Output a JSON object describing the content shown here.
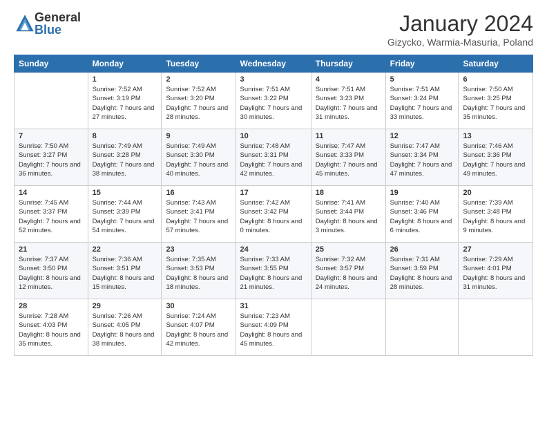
{
  "logo": {
    "general": "General",
    "blue": "Blue"
  },
  "header": {
    "title": "January 2024",
    "location": "Gizycko, Warmia-Masuria, Poland"
  },
  "weekdays": [
    "Sunday",
    "Monday",
    "Tuesday",
    "Wednesday",
    "Thursday",
    "Friday",
    "Saturday"
  ],
  "weeks": [
    [
      {
        "day": "",
        "sunrise": "",
        "sunset": "",
        "daylight": ""
      },
      {
        "day": "1",
        "sunrise": "Sunrise: 7:52 AM",
        "sunset": "Sunset: 3:19 PM",
        "daylight": "Daylight: 7 hours and 27 minutes."
      },
      {
        "day": "2",
        "sunrise": "Sunrise: 7:52 AM",
        "sunset": "Sunset: 3:20 PM",
        "daylight": "Daylight: 7 hours and 28 minutes."
      },
      {
        "day": "3",
        "sunrise": "Sunrise: 7:51 AM",
        "sunset": "Sunset: 3:22 PM",
        "daylight": "Daylight: 7 hours and 30 minutes."
      },
      {
        "day": "4",
        "sunrise": "Sunrise: 7:51 AM",
        "sunset": "Sunset: 3:23 PM",
        "daylight": "Daylight: 7 hours and 31 minutes."
      },
      {
        "day": "5",
        "sunrise": "Sunrise: 7:51 AM",
        "sunset": "Sunset: 3:24 PM",
        "daylight": "Daylight: 7 hours and 33 minutes."
      },
      {
        "day": "6",
        "sunrise": "Sunrise: 7:50 AM",
        "sunset": "Sunset: 3:25 PM",
        "daylight": "Daylight: 7 hours and 35 minutes."
      }
    ],
    [
      {
        "day": "7",
        "sunrise": "Sunrise: 7:50 AM",
        "sunset": "Sunset: 3:27 PM",
        "daylight": "Daylight: 7 hours and 36 minutes."
      },
      {
        "day": "8",
        "sunrise": "Sunrise: 7:49 AM",
        "sunset": "Sunset: 3:28 PM",
        "daylight": "Daylight: 7 hours and 38 minutes."
      },
      {
        "day": "9",
        "sunrise": "Sunrise: 7:49 AM",
        "sunset": "Sunset: 3:30 PM",
        "daylight": "Daylight: 7 hours and 40 minutes."
      },
      {
        "day": "10",
        "sunrise": "Sunrise: 7:48 AM",
        "sunset": "Sunset: 3:31 PM",
        "daylight": "Daylight: 7 hours and 42 minutes."
      },
      {
        "day": "11",
        "sunrise": "Sunrise: 7:47 AM",
        "sunset": "Sunset: 3:33 PM",
        "daylight": "Daylight: 7 hours and 45 minutes."
      },
      {
        "day": "12",
        "sunrise": "Sunrise: 7:47 AM",
        "sunset": "Sunset: 3:34 PM",
        "daylight": "Daylight: 7 hours and 47 minutes."
      },
      {
        "day": "13",
        "sunrise": "Sunrise: 7:46 AM",
        "sunset": "Sunset: 3:36 PM",
        "daylight": "Daylight: 7 hours and 49 minutes."
      }
    ],
    [
      {
        "day": "14",
        "sunrise": "Sunrise: 7:45 AM",
        "sunset": "Sunset: 3:37 PM",
        "daylight": "Daylight: 7 hours and 52 minutes."
      },
      {
        "day": "15",
        "sunrise": "Sunrise: 7:44 AM",
        "sunset": "Sunset: 3:39 PM",
        "daylight": "Daylight: 7 hours and 54 minutes."
      },
      {
        "day": "16",
        "sunrise": "Sunrise: 7:43 AM",
        "sunset": "Sunset: 3:41 PM",
        "daylight": "Daylight: 7 hours and 57 minutes."
      },
      {
        "day": "17",
        "sunrise": "Sunrise: 7:42 AM",
        "sunset": "Sunset: 3:42 PM",
        "daylight": "Daylight: 8 hours and 0 minutes."
      },
      {
        "day": "18",
        "sunrise": "Sunrise: 7:41 AM",
        "sunset": "Sunset: 3:44 PM",
        "daylight": "Daylight: 8 hours and 3 minutes."
      },
      {
        "day": "19",
        "sunrise": "Sunrise: 7:40 AM",
        "sunset": "Sunset: 3:46 PM",
        "daylight": "Daylight: 8 hours and 6 minutes."
      },
      {
        "day": "20",
        "sunrise": "Sunrise: 7:39 AM",
        "sunset": "Sunset: 3:48 PM",
        "daylight": "Daylight: 8 hours and 9 minutes."
      }
    ],
    [
      {
        "day": "21",
        "sunrise": "Sunrise: 7:37 AM",
        "sunset": "Sunset: 3:50 PM",
        "daylight": "Daylight: 8 hours and 12 minutes."
      },
      {
        "day": "22",
        "sunrise": "Sunrise: 7:36 AM",
        "sunset": "Sunset: 3:51 PM",
        "daylight": "Daylight: 8 hours and 15 minutes."
      },
      {
        "day": "23",
        "sunrise": "Sunrise: 7:35 AM",
        "sunset": "Sunset: 3:53 PM",
        "daylight": "Daylight: 8 hours and 18 minutes."
      },
      {
        "day": "24",
        "sunrise": "Sunrise: 7:33 AM",
        "sunset": "Sunset: 3:55 PM",
        "daylight": "Daylight: 8 hours and 21 minutes."
      },
      {
        "day": "25",
        "sunrise": "Sunrise: 7:32 AM",
        "sunset": "Sunset: 3:57 PM",
        "daylight": "Daylight: 8 hours and 24 minutes."
      },
      {
        "day": "26",
        "sunrise": "Sunrise: 7:31 AM",
        "sunset": "Sunset: 3:59 PM",
        "daylight": "Daylight: 8 hours and 28 minutes."
      },
      {
        "day": "27",
        "sunrise": "Sunrise: 7:29 AM",
        "sunset": "Sunset: 4:01 PM",
        "daylight": "Daylight: 8 hours and 31 minutes."
      }
    ],
    [
      {
        "day": "28",
        "sunrise": "Sunrise: 7:28 AM",
        "sunset": "Sunset: 4:03 PM",
        "daylight": "Daylight: 8 hours and 35 minutes."
      },
      {
        "day": "29",
        "sunrise": "Sunrise: 7:26 AM",
        "sunset": "Sunset: 4:05 PM",
        "daylight": "Daylight: 8 hours and 38 minutes."
      },
      {
        "day": "30",
        "sunrise": "Sunrise: 7:24 AM",
        "sunset": "Sunset: 4:07 PM",
        "daylight": "Daylight: 8 hours and 42 minutes."
      },
      {
        "day": "31",
        "sunrise": "Sunrise: 7:23 AM",
        "sunset": "Sunset: 4:09 PM",
        "daylight": "Daylight: 8 hours and 45 minutes."
      },
      {
        "day": "",
        "sunrise": "",
        "sunset": "",
        "daylight": ""
      },
      {
        "day": "",
        "sunrise": "",
        "sunset": "",
        "daylight": ""
      },
      {
        "day": "",
        "sunrise": "",
        "sunset": "",
        "daylight": ""
      }
    ]
  ]
}
